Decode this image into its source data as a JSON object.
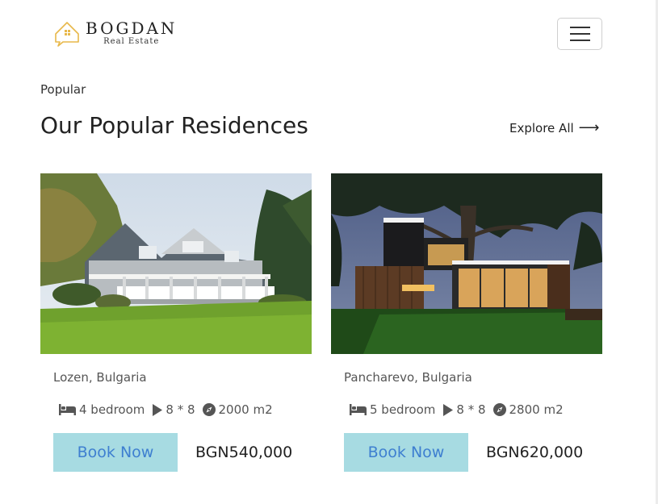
{
  "brand": {
    "name": "BOGDAN",
    "tagline": "Real Estate",
    "accent": "#e8b84a"
  },
  "section": {
    "eyebrow": "Popular",
    "title": "Our Popular Residences",
    "explore_label": "Explore All",
    "explore_arrow": "⟶"
  },
  "colors": {
    "button_bg": "#a7dbe2",
    "button_text": "#3e7fd0"
  },
  "listings": [
    {
      "location": "Lozen, Bulgaria",
      "bedrooms": "4 bedroom",
      "dimensions": "8 * 8",
      "area": "2000 m2",
      "button_label": "Book Now",
      "price": "BGN540,000",
      "icons": [
        "bed-icon",
        "play-icon",
        "compass-icon"
      ]
    },
    {
      "location": "Pancharevo, Bulgaria",
      "bedrooms": "5 bedroom",
      "dimensions": "8 * 8",
      "area": "2800 m2",
      "button_label": "Book Now",
      "price": "BGN620,000",
      "icons": [
        "bed-icon",
        "play-icon",
        "compass-icon"
      ]
    }
  ]
}
